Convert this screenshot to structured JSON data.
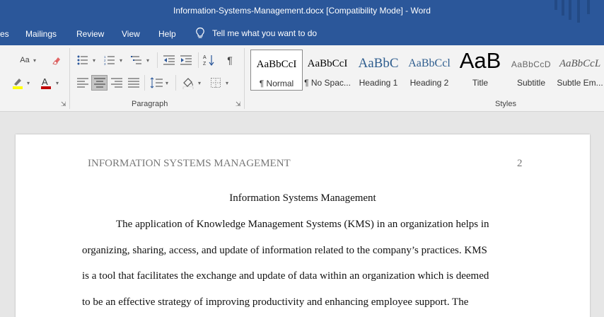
{
  "window": {
    "title": "Information-Systems-Management.docx [Compatibility Mode]  -  Word"
  },
  "menu": {
    "tabs": [
      "es",
      "Mailings",
      "Review",
      "View",
      "Help"
    ],
    "tell_me": "Tell me what you want to do"
  },
  "ribbon": {
    "font_group": {
      "change_case": "Aa",
      "font_color": "#c00000",
      "highlight_color": "#ffff00"
    },
    "paragraph": {
      "label": "Paragraph",
      "pilcrow": "¶",
      "sort": "A↓Z"
    },
    "styles": {
      "label": "Styles",
      "items": [
        {
          "sample": "AaBbCcI",
          "name": "¶ Normal",
          "selected": true
        },
        {
          "sample": "AaBbCcI",
          "name": "¶ No Spac...",
          "selected": false
        },
        {
          "sample": "AaBbC",
          "name": "Heading 1",
          "selected": false
        },
        {
          "sample": "AaBbCcl",
          "name": "Heading 2",
          "selected": false
        },
        {
          "sample": "AaB",
          "name": "Title",
          "selected": false
        },
        {
          "sample": "AaBbCcD",
          "name": "Subtitle",
          "selected": false
        },
        {
          "sample": "AaBbCcL",
          "name": "Subtle Em...",
          "selected": false
        }
      ]
    }
  },
  "document": {
    "header_text": "INFORMATION SYSTEMS MANAGEMENT",
    "page_number": "2",
    "title": "Information Systems Management",
    "lines": [
      "The application of Knowledge Management Systems (KMS) in an organization helps in",
      "organizing, sharing, access, and update of information related to the company’s practices. KMS",
      "is a tool that facilitates the exchange and update of data within an organization which is deemed",
      "to be an effective strategy of improving productivity and enhancing employee support. The"
    ]
  }
}
